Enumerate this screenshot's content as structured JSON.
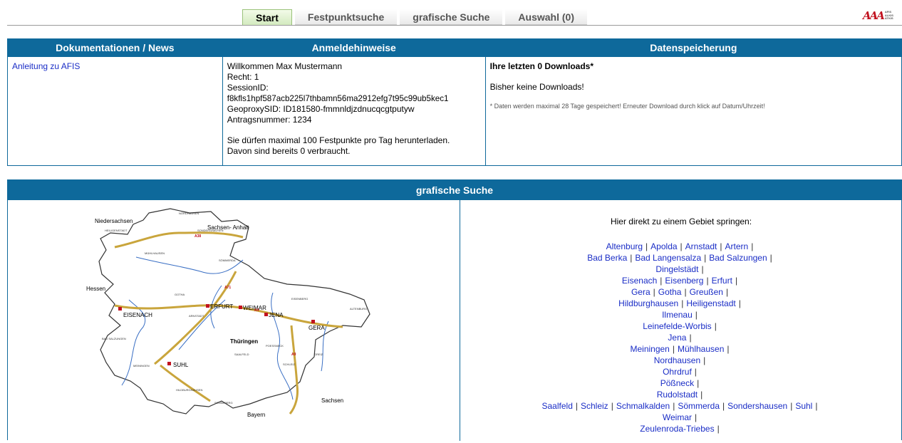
{
  "tabs": [
    {
      "label": "Start",
      "active": true
    },
    {
      "label": "Festpunktsuche",
      "active": false
    },
    {
      "label": "grafische Suche",
      "active": false
    },
    {
      "label": "Auswahl (0)",
      "active": false
    }
  ],
  "logo": {
    "mark": "AAA",
    "text_lines": [
      "AFIS",
      "ALKIS",
      "ATKIS"
    ]
  },
  "headers": {
    "docs": "Dokumentationen / News",
    "login": "Anmeldehinweise",
    "storage": "Datenspeicherung"
  },
  "docs": {
    "link": "Anleitung zu AFIS"
  },
  "login": {
    "welcome": "Willkommen Max Mustermann",
    "recht": "Recht: 1",
    "session_label": "SessionID:",
    "session_id": "f8kfls1hpf587acb225l7thbamn56ma2912efg7t95c99ub5kec1",
    "geoproxy": "GeoproxySID: ID181580-fmmnldjzdnucqcgtputyw",
    "antrag": "Antragsnummer: 1234",
    "limit1": "Sie dürfen maximal 100 Festpunkte pro Tag herunterladen.",
    "limit2": "Davon sind bereits 0 verbraucht."
  },
  "storage": {
    "title": "Ihre letzten 0 Downloads*",
    "none": "Bisher keine Downloads!",
    "note": "* Daten werden maximal 28 Tage gespeichert! Erneuter Download durch klick auf Datum/Uhrzeit!"
  },
  "grafische_suche": {
    "title": "grafische Suche",
    "jump_title": "Hier direkt zu einem Gebiet springen:",
    "city_rows": [
      [
        "Altenburg",
        "Apolda",
        "Arnstadt",
        "Artern"
      ],
      [
        "Bad Berka",
        "Bad Langensalza",
        "Bad Salzungen"
      ],
      [
        "Dingelstädt"
      ],
      [
        "Eisenach",
        "Eisenberg",
        "Erfurt"
      ],
      [
        "Gera",
        "Gotha",
        "Greußen"
      ],
      [
        "Hildburghausen",
        "Heiligenstadt"
      ],
      [
        "Ilmenau"
      ],
      [
        "Leinefelde-Worbis"
      ],
      [
        "Jena"
      ],
      [
        "Meiningen",
        "Mühlhausen"
      ],
      [
        "Nordhausen"
      ],
      [
        "Ohrdruf"
      ],
      [
        "Pößneck"
      ],
      [
        "Rudolstadt"
      ],
      [
        "Saalfeld",
        "Schleiz",
        "Schmalkalden",
        "Sömmerda",
        "Sondershausen",
        "Suhl"
      ],
      [
        "Weimar"
      ],
      [
        "Zeulenroda-Triebes"
      ]
    ]
  },
  "map": {
    "regions": [
      "Niedersachsen",
      "Sachsen- Anhalt",
      "Hessen",
      "Thüringen",
      "Sachsen",
      "Bayern"
    ],
    "cities_major": [
      "EISENACH",
      "ERFURT",
      "WEIMAR",
      "JENA",
      "GERA",
      "SUHL"
    ],
    "cities_minor": [
      "NORDHAUSEN",
      "SONDERSHAUSEN",
      "MÜHLHAUSEN",
      "SÖMMERDA",
      "HEILIGENSTADT",
      "GOTHA",
      "ARNSTADT",
      "ALTENBURG",
      "EISENBERG",
      "BAD SALZUNGEN",
      "MEININGEN",
      "HILDBURGHAUSEN",
      "SONNEBERG",
      "SAALFELD",
      "POESSNECK",
      "SCHLEIZ",
      "GREIZ"
    ],
    "roads": [
      "A38",
      "A71",
      "A4",
      "A9"
    ]
  }
}
